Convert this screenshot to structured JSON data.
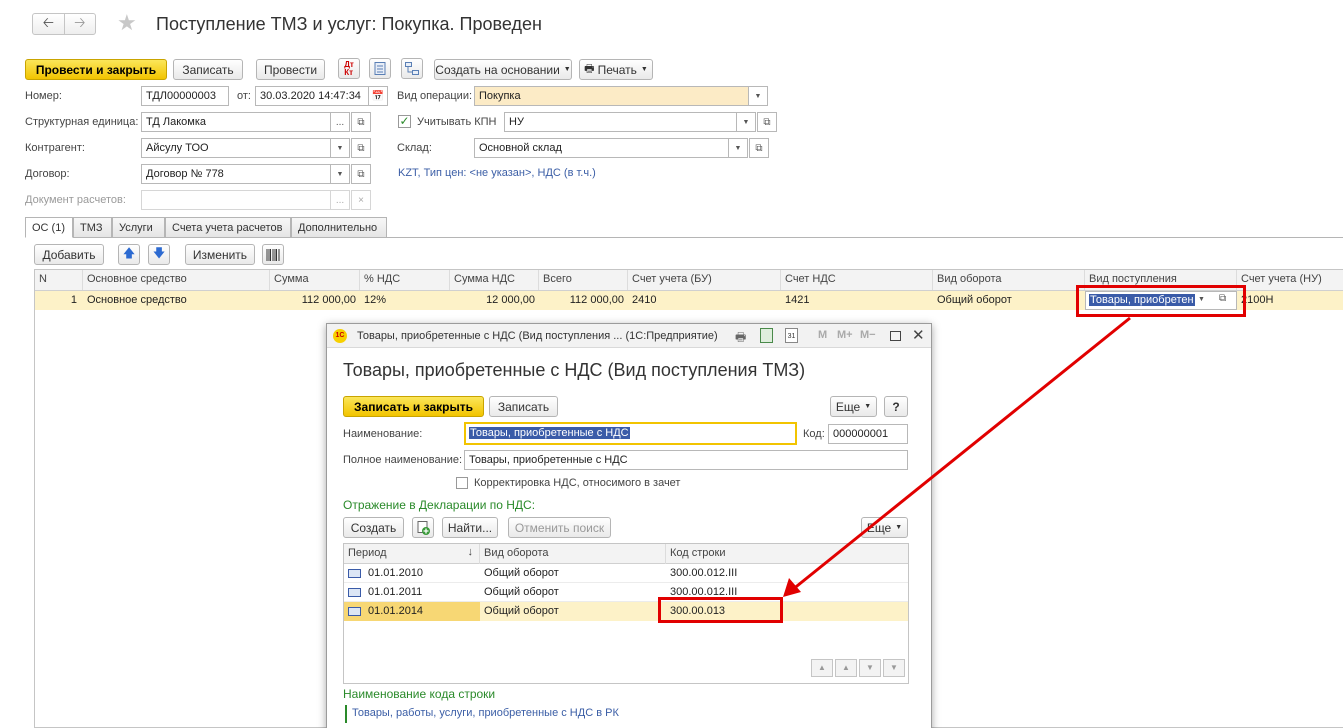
{
  "header": {
    "title": "Поступление ТМЗ и услуг: Покупка. Проведен"
  },
  "toolbar": {
    "post_close": "Провести и закрыть",
    "save": "Записать",
    "post": "Провести",
    "create_based": "Создать на основании",
    "print": "Печать"
  },
  "form": {
    "number_label": "Номер:",
    "number_value": "ТДЛ00000003",
    "date_label": "от:",
    "date_value": "30.03.2020 14:47:34",
    "operation_label": "Вид операции:",
    "operation_value": "Покупка",
    "unit_label": "Структурная единица:",
    "unit_value": "ТД Лакомка",
    "kpn_label": "Учитывать КПН",
    "kpn_value": "НУ",
    "contractor_label": "Контрагент:",
    "contractor_value": "Айсулу ТОО",
    "warehouse_label": "Склад:",
    "warehouse_value": "Основной склад",
    "contract_label": "Договор:",
    "contract_value": "Договор № 778",
    "prices_link": "KZT, Тип цен: <не указан>, НДС (в т.ч.)",
    "settlement_doc_label": "Документ расчетов:"
  },
  "tabs": [
    "ОС (1)",
    "ТМЗ",
    "Услуги",
    "Счета учета расчетов",
    "Дополнительно"
  ],
  "table_toolbar": {
    "add": "Добавить",
    "change": "Изменить"
  },
  "table": {
    "headers": [
      "N",
      "Основное средство",
      "Сумма",
      "% НДС",
      "Сумма НДС",
      "Всего",
      "Счет учета (БУ)",
      "Счет НДС",
      "Вид оборота",
      "Вид поступления",
      "Счет учета (НУ)"
    ],
    "row": {
      "n": "1",
      "asset": "Основное средство",
      "sum": "112 000,00",
      "vat_rate": "12%",
      "vat_sum": "12 000,00",
      "total": "112 000,00",
      "account_bu": "2410",
      "account_vat": "1421",
      "turnover": "Общий оборот",
      "receipt_type": "Товары, приобретен",
      "account_nu": "2100Н"
    }
  },
  "dialog": {
    "window_title": "Товары, приобретенные с НДС (Вид поступления ... (1С:Предприятие)",
    "heading": "Товары, приобретенные с НДС (Вид поступления ТМЗ)",
    "save_close": "Записать и закрыть",
    "save": "Записать",
    "more": "Еще",
    "help": "?",
    "name_label": "Наименование:",
    "name_value": "Товары, приобретенные с НДС",
    "code_label": "Код:",
    "code_value": "000000001",
    "fullname_label": "Полное наименование:",
    "fullname_value": "Товары, приобретенные с НДС",
    "correction_label": "Корректировка НДС, относимого в зачет",
    "section_title": "Отражение в Декларации по НДС:",
    "create": "Создать",
    "find": "Найти...",
    "cancel_search": "Отменить поиск",
    "more2": "Еще",
    "grid_headers": [
      "Период",
      "Вид оборота",
      "Код строки"
    ],
    "rows": [
      {
        "period": "01.01.2010",
        "turnover": "Общий оборот",
        "code": "300.00.012.III"
      },
      {
        "period": "01.01.2011",
        "turnover": "Общий оборот",
        "code": "300.00.012.III"
      },
      {
        "period": "01.01.2014",
        "turnover": "Общий оборот",
        "code": "300.00.013"
      }
    ],
    "code_name_title": "Наименование кода строки",
    "code_name_value": "Товары, работы, услуги, приобретенные с НДС в РК"
  },
  "colors": {
    "accent_yellow": "#f2c400",
    "selected_row": "#fdf2c8",
    "highlight_red": "#e10000",
    "section_green": "#2a8a2a"
  }
}
